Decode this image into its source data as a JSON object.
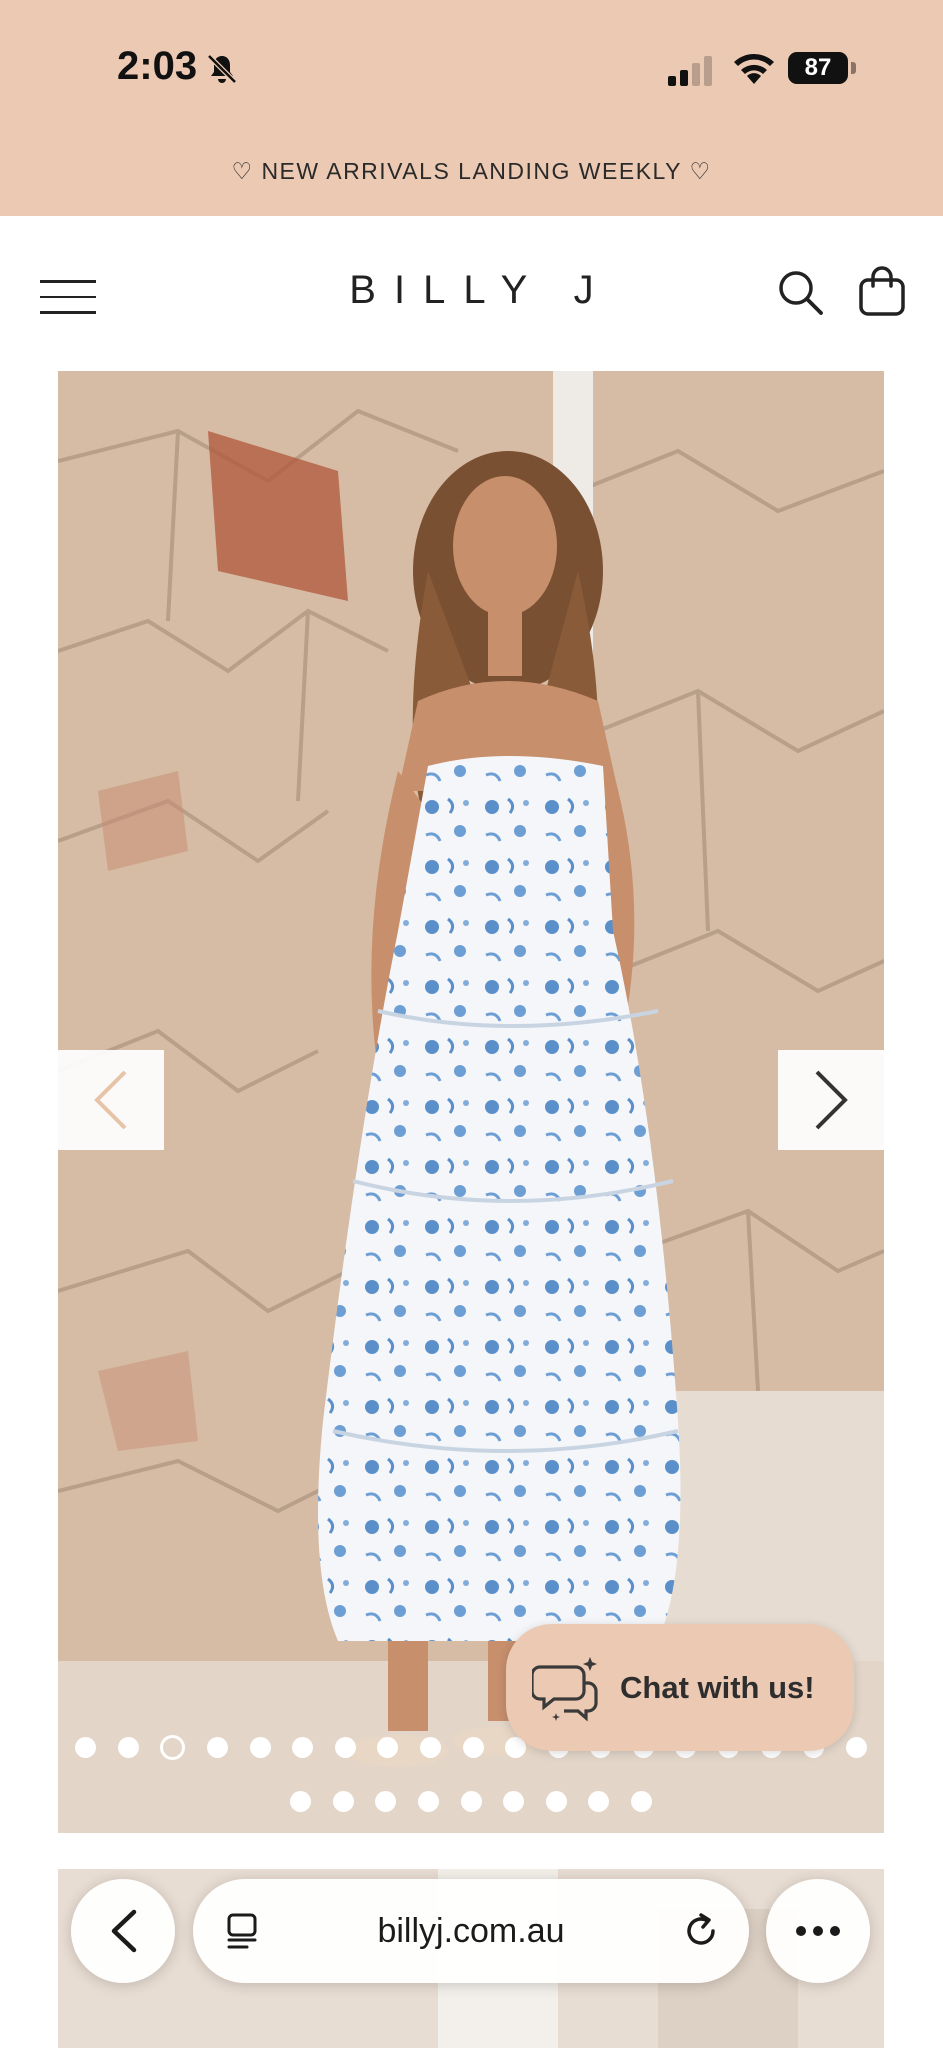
{
  "status_bar": {
    "time": "2:03",
    "battery": "87",
    "icons": [
      "bell-off-icon",
      "signal-icon",
      "wifi-icon",
      "battery-icon"
    ]
  },
  "announcement": "♡ NEW ARRIVALS LANDING WEEKLY ♡",
  "header": {
    "brand": "BILLY J",
    "icons": [
      "menu-icon",
      "search-icon",
      "bag-icon"
    ]
  },
  "product_gallery": {
    "current_slide": 3,
    "total_slides": 28,
    "arrows": [
      "chevron-left-icon",
      "chevron-right-icon"
    ]
  },
  "chat": {
    "label": "Chat with us!",
    "icon": "chat-bubbles-icon"
  },
  "browser": {
    "url": "billyj.com.au",
    "icons": [
      "back-icon",
      "reader-icon",
      "reload-icon",
      "more-icon"
    ]
  },
  "colors": {
    "accent": "#ecc9b2",
    "text": "#222222"
  }
}
